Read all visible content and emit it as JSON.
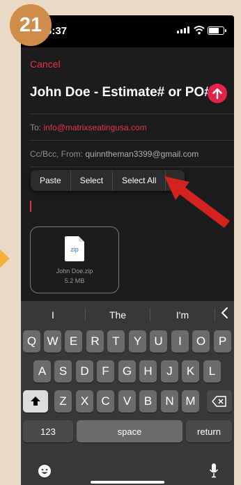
{
  "step_badge": "21",
  "status_bar": {
    "time": "6:37"
  },
  "compose": {
    "cancel_label": "Cancel",
    "subject": "John Doe - Estimate# or PO#",
    "to_label": "To:",
    "to_address": "info@matrixseatingusa.com",
    "cc_label": "Cc/Bcc, From:",
    "from_address": "quinntheman3399@gmail.com"
  },
  "edit_menu": {
    "items": [
      "Paste",
      "Select",
      "Select All"
    ],
    "more": ">"
  },
  "attachment": {
    "icon_label": "zip",
    "filename": "John Doe.zip",
    "size": "5.2 MB"
  },
  "keyboard": {
    "predictions": [
      "I",
      "The",
      "I'm"
    ],
    "row1": [
      "Q",
      "W",
      "E",
      "R",
      "T",
      "Y",
      "U",
      "I",
      "O",
      "P"
    ],
    "row2": [
      "A",
      "S",
      "D",
      "F",
      "G",
      "H",
      "J",
      "K",
      "L"
    ],
    "row3": [
      "Z",
      "X",
      "C",
      "V",
      "B",
      "N",
      "M"
    ],
    "numbers_label": "123",
    "space_label": "space",
    "return_label": "return"
  },
  "colors": {
    "accent": "#e8324a",
    "badge": "#d08c4a",
    "annotation_arrow": "#d4221e",
    "side_arrow": "#f2b23a"
  },
  "icons": [
    "signal-icon",
    "wifi-icon",
    "battery-icon",
    "send-arrow-icon",
    "zip-file-icon",
    "shift-icon",
    "backspace-icon",
    "emoji-icon",
    "microphone-icon",
    "chevron-left-icon"
  ]
}
